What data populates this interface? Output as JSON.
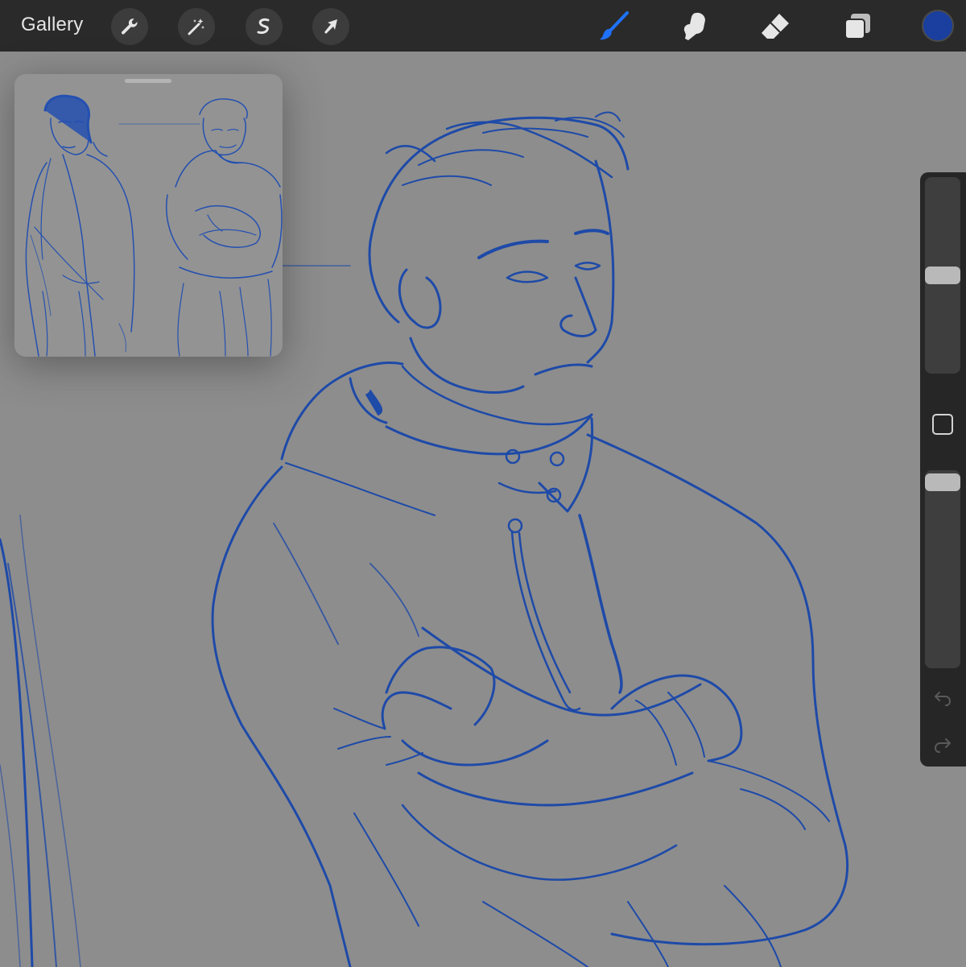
{
  "toolbar": {
    "gallery_label": "Gallery",
    "left_tools": [
      {
        "name": "actions",
        "icon": "wrench-icon"
      },
      {
        "name": "adjustments",
        "icon": "magic-wand-icon"
      },
      {
        "name": "selection",
        "icon": "selection-s-icon"
      },
      {
        "name": "transform",
        "icon": "arrow-cursor-icon"
      }
    ],
    "right_tools": [
      {
        "name": "brush",
        "icon": "brush-icon",
        "active": true
      },
      {
        "name": "smudge",
        "icon": "smudge-finger-icon",
        "active": false
      },
      {
        "name": "eraser",
        "icon": "eraser-icon",
        "active": false
      },
      {
        "name": "layers",
        "icon": "layers-icon",
        "active": false
      }
    ],
    "current_color": "#1a3f9e"
  },
  "colors": {
    "toolbar_bg": "#2a2a2a",
    "canvas_bg": "#8d8d8d",
    "ink": "#1e4aa8",
    "active_tool": "#1f72ff"
  },
  "reference_window": {
    "label": "reference"
  },
  "sidebar": {
    "brush_size": 0.5,
    "opacity": 1.0,
    "undo_icon": "undo-arrow-icon",
    "redo_icon": "redo-arrow-icon",
    "modify_icon": "square-modify-icon"
  }
}
